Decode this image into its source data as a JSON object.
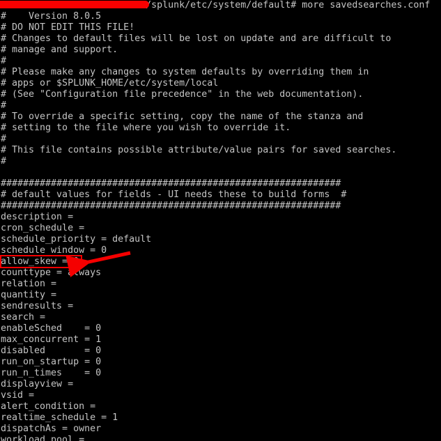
{
  "terminal": {
    "title": "terminal-savedsearches-conf",
    "background_color": "#000000",
    "text_color": "#c4c4c4",
    "prompt": {
      "redacted_prefix": "",
      "path": "/splunk/etc/system/default#",
      "command": " more savedsearches.conf",
      "full_visible_text": "/splunk/etc/system/default# more savedsearches.conf"
    },
    "annotations": {
      "redaction_color": "#f90000",
      "highlight_color": "#f50000",
      "highlighted_setting": "allow_skew = 0",
      "arrow_label": "pointer-to-allow-skew"
    },
    "lines": [
      "#    Version 8.0.5",
      "# DO NOT EDIT THIS FILE!",
      "# Changes to default files will be lost on update and are difficult to",
      "# manage and support.",
      "#",
      "# Please make any changes to system defaults by overriding them in",
      "# apps or $SPLUNK_HOME/etc/system/local",
      "# (See \"Configuration file precedence\" in the web documentation).",
      "#",
      "# To override a specific setting, copy the name of the stanza and",
      "# setting to the file where you wish to override it.",
      "#",
      "# This file contains possible attribute/value pairs for saved searches.",
      "#",
      "",
      "#############################################################",
      "# default values for fields - UI needs these to build forms  #",
      "#############################################################",
      "description =",
      "cron_schedule =",
      "schedule_priority = default",
      "schedule window = 0",
      "allow_skew = 0",
      "counttype = always",
      "relation =",
      "quantity =",
      "sendresults =",
      "search =",
      "enableSched    = 0",
      "max_concurrent = 1",
      "disabled       = 0",
      "run_on_startup = 0",
      "run_n_times    = 0",
      "displayview =",
      "vsid =",
      "alert_condition =",
      "realtime_schedule = 1",
      "dispatchAs = owner",
      "workload_pool ="
    ]
  }
}
